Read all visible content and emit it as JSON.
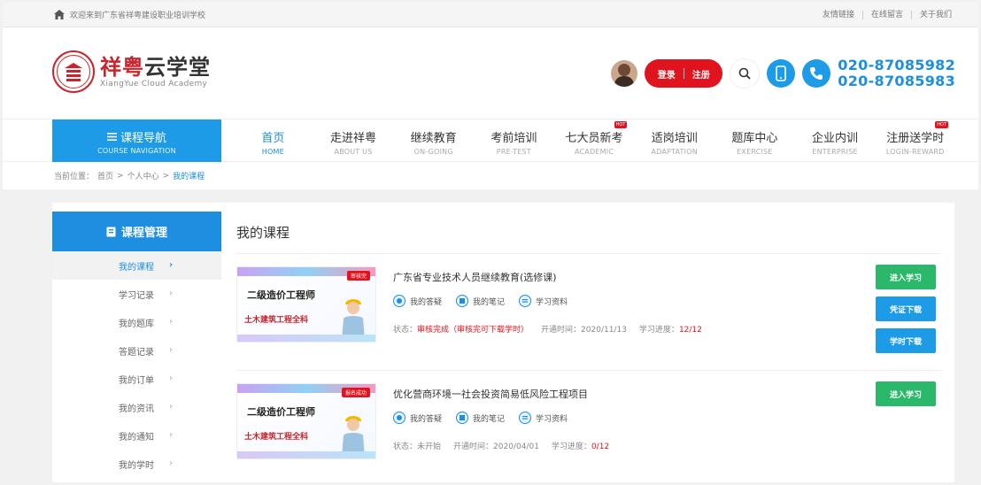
{
  "topbar": {
    "welcome": "欢迎来到广东省祥粤建设职业培训学校",
    "links": [
      "友情链接",
      "在线留言",
      "关于我们"
    ]
  },
  "header": {
    "logo_cn_red": "祥粤",
    "logo_cn_black": "云学堂",
    "logo_en": "XiangYue Cloud Academy",
    "login_label": "登录",
    "register_label": "注册",
    "phone_1": "020-87085982",
    "phone_2": "020-87085983"
  },
  "nav": {
    "course_cn": "课程导航",
    "course_en": "COURSE NAVIGATION",
    "items": [
      {
        "cn": "首页",
        "en": "HOME"
      },
      {
        "cn": "走进祥粤",
        "en": "ABOUT US"
      },
      {
        "cn": "继续教育",
        "en": "ON-GOING"
      },
      {
        "cn": "考前培训",
        "en": "PRE-TEST"
      },
      {
        "cn": "七大员新考",
        "en": "ACADEMIC"
      },
      {
        "cn": "适岗培训",
        "en": "ADAPTATION"
      },
      {
        "cn": "题库中心",
        "en": "EXERCISE"
      },
      {
        "cn": "企业内训",
        "en": "ENTERPRISE"
      },
      {
        "cn": "注册送学时",
        "en": "LOGIN-REWARD"
      }
    ],
    "hot_label": "HOT"
  },
  "breadcrumb": {
    "prefix": "当前位置：",
    "home": "首页",
    "center": "个人中心",
    "current": "我的课程",
    "sep": ">"
  },
  "sidebar": {
    "title": "课程管理",
    "items": [
      "我的课程",
      "学习记录",
      "我的题库",
      "答题记录",
      "我的订单",
      "我的资讯",
      "我的通知",
      "我的学时"
    ]
  },
  "content": {
    "title": "我的课程",
    "courses": [
      {
        "thumb_tag": "审核完",
        "thumb_title": "二级造价工程师",
        "thumb_sub": "土木建筑工程全科",
        "title": "广东省专业技术人员继续教育(选修课)",
        "tools": [
          "我的答疑",
          "我的笔记",
          "学习资料"
        ],
        "status_label": "状态：",
        "status": "审核完成（审核完可下载学时）",
        "open_label": "开通时间：",
        "open_date": "2020/11/13",
        "progress_label": "学习进度：",
        "progress": "12/12",
        "buttons": [
          "进入学习",
          "凭证下载",
          "学时下载"
        ]
      },
      {
        "thumb_tag": "报名成功",
        "thumb_title": "二级造价工程师",
        "thumb_sub": "土木建筑工程全科",
        "title": "优化营商环境一社会投资简易低风险工程项目",
        "tools": [
          "我的答疑",
          "我的笔记",
          "学习资料"
        ],
        "status_label": "状态：",
        "status": "未开始",
        "open_label": "开通时间：",
        "open_date": "2020/04/01",
        "progress_label": "学习进度：",
        "progress": "0/12",
        "buttons": [
          "进入学习"
        ]
      }
    ]
  },
  "colors": {
    "brand_red": "#c8262f",
    "accent_blue": "#1e9be6",
    "button_green": "#2cb86b",
    "status_red": "#e0141e"
  }
}
